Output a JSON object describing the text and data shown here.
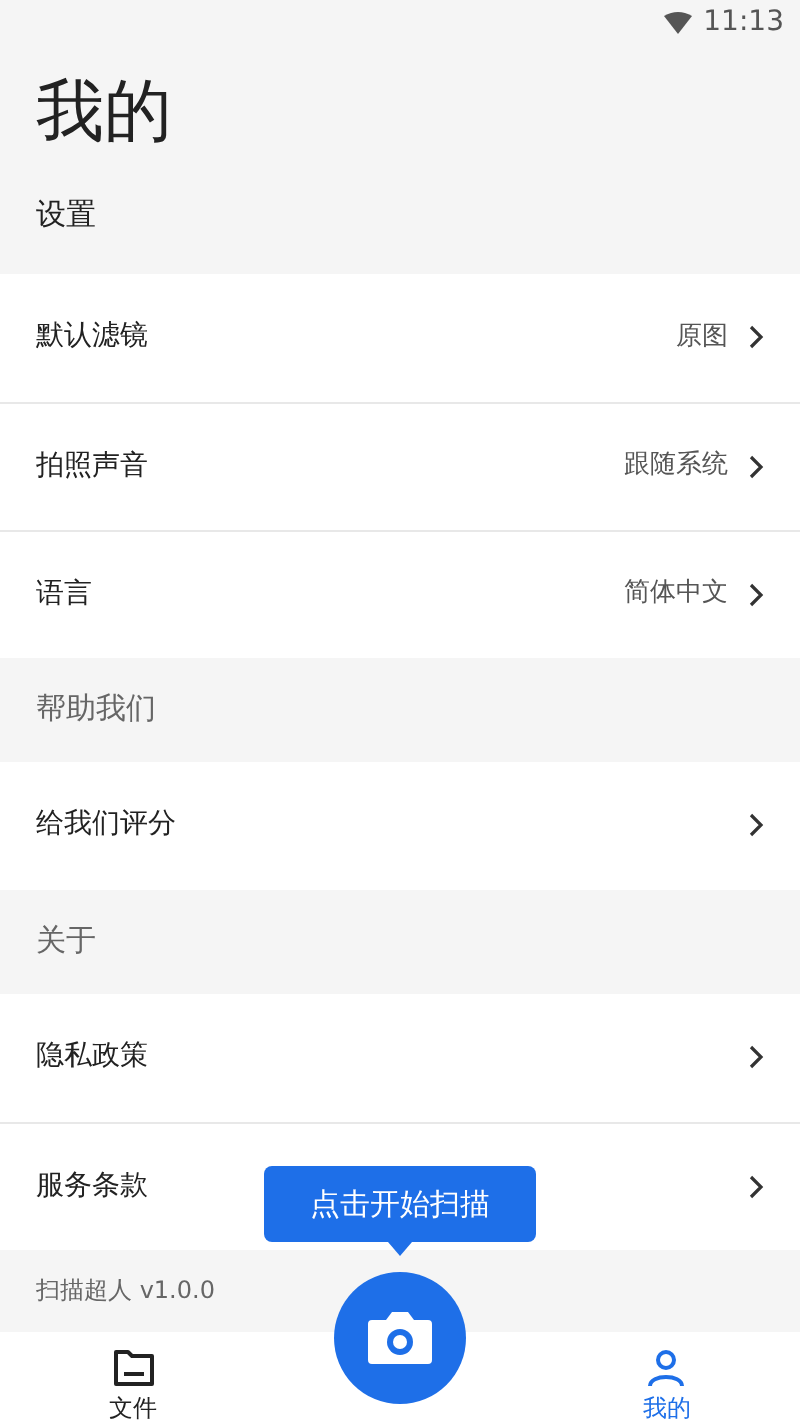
{
  "status_bar": {
    "time": "11:13"
  },
  "title": "我的",
  "sections": [
    {
      "header": "设置",
      "rows": [
        {
          "label": "默认滤镜",
          "value": "原图"
        },
        {
          "label": "拍照声音",
          "value": "跟随系统"
        },
        {
          "label": "语言",
          "value": "简体中文"
        }
      ]
    },
    {
      "header": "帮助我们",
      "rows": [
        {
          "label": "给我们评分"
        }
      ]
    },
    {
      "header": "关于",
      "rows": [
        {
          "label": "隐私政策"
        },
        {
          "label": "服务条款"
        }
      ]
    }
  ],
  "version": "扫描超人 v1.0.0",
  "tooltip": "点击开始扫描",
  "tabs": [
    {
      "label": "文件",
      "kind": "files",
      "selected": false
    },
    {
      "label": "我的",
      "kind": "me",
      "selected": true
    }
  ]
}
